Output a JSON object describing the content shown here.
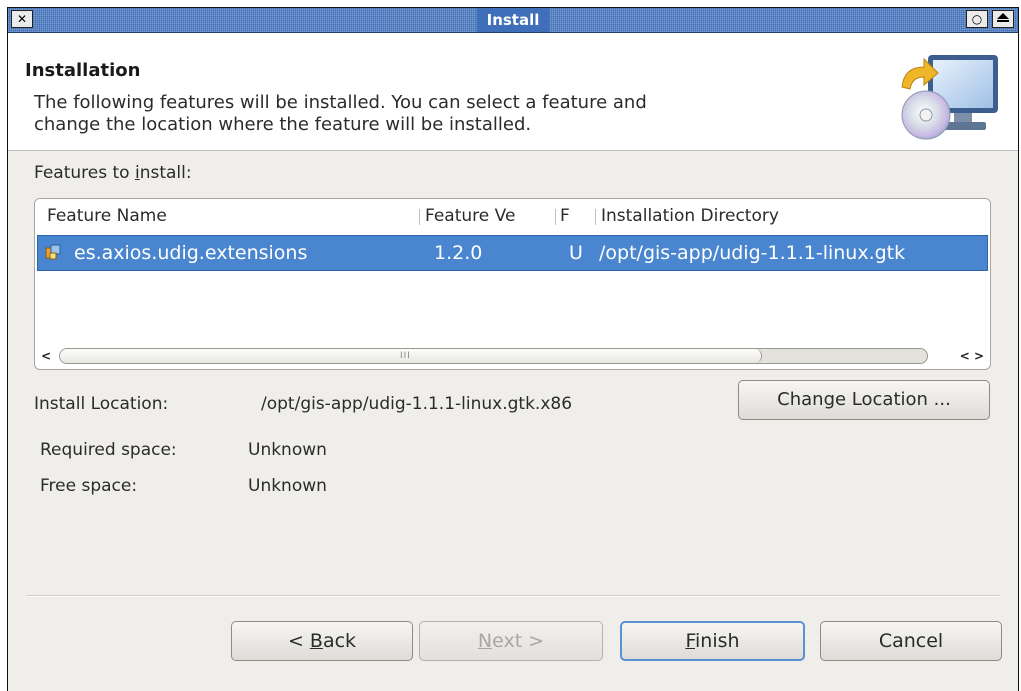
{
  "window": {
    "title": "Install",
    "close_glyph": "✕",
    "option_glyph": "○",
    "shade_icon": "eject-icon"
  },
  "banner": {
    "title": "Installation",
    "message_line1": "The following features will be installed. You can select a feature and",
    "message_line2": "change the location where the feature will be installed.",
    "icon": "install-cd-monitor-icon"
  },
  "features": {
    "label": "Features to install:",
    "label_prefix": "Features to ",
    "label_mnemonic": "i",
    "label_suffix": "nstall:",
    "columns": [
      "Feature Name",
      "Feature Ve",
      "F",
      "Installation Directory"
    ],
    "rows": [
      {
        "name": "es.axios.udig.extensions",
        "version": "1.2.0",
        "flag": "U",
        "directory": "/opt/gis-app/udig-1.1.1-linux.gtk",
        "selected": true
      }
    ],
    "scrollbar_grip": "III"
  },
  "install_location": {
    "label": "Install Location:",
    "value": "/opt/gis-app/udig-1.1.1-linux.gtk.x86",
    "change_button": "Change Location ..."
  },
  "space": {
    "required_label": "Required space:",
    "required_value": "Unknown",
    "free_label": "Free space:",
    "free_value": "Unknown"
  },
  "buttons": {
    "back_prefix": "< ",
    "back_mnemonic": "B",
    "back_suffix": "ack",
    "next_mnemonic": "N",
    "next_suffix": "ext >",
    "finish_mnemonic": "F",
    "finish_suffix": "inish",
    "cancel": "Cancel"
  },
  "colors": {
    "titlebar": "#3f6fb8",
    "selection": "#4a86cf",
    "focus_border": "#5a8fd1"
  }
}
